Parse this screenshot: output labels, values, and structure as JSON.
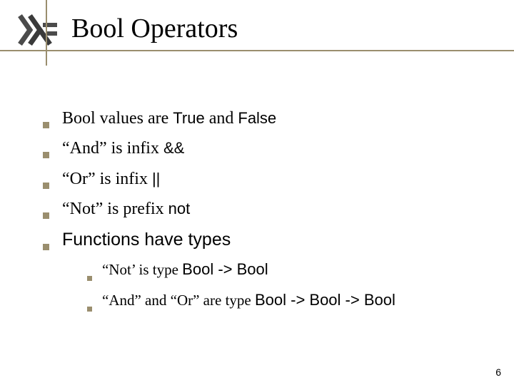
{
  "title": "Bool Operators",
  "bullets": [
    {
      "pre": "Bool values are ",
      "e1": "True",
      "mid": " and ",
      "e2": "False"
    },
    {
      "pre": "“And” is infix ",
      "e1": "&&",
      "mid": "",
      "e2": ""
    },
    {
      "pre": "“Or” is infix ",
      "e1": "||",
      "mid": "",
      "e2": ""
    },
    {
      "pre": "“Not” is prefix ",
      "e1": "not",
      "mid": "",
      "e2": ""
    }
  ],
  "bullet5": "Functions have types",
  "subs": [
    {
      "pre": "“Not’ is type  ",
      "e": "Bool -> Bool"
    },
    {
      "pre": "“And” and “Or” are type  ",
      "e": "Bool -> Bool -> Bool"
    }
  ],
  "page": "6"
}
